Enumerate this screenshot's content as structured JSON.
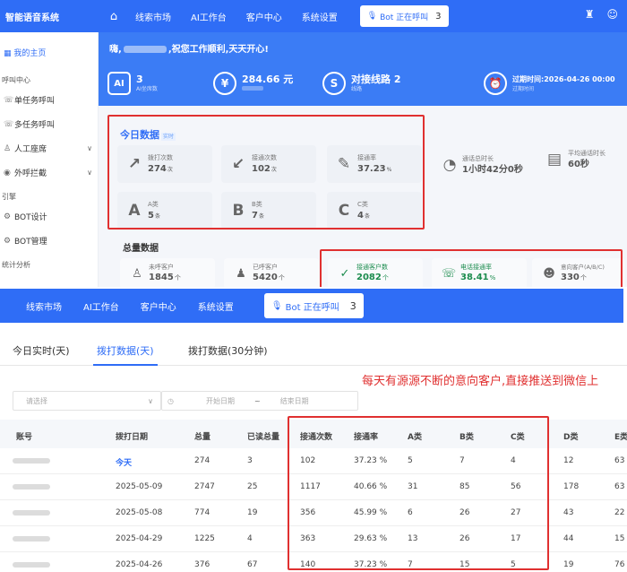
{
  "header": {
    "logo": "智能语音系统",
    "nav": [
      "线索市场",
      "AI工作台",
      "客户中心",
      "系统设置"
    ],
    "bot_status": "Bot 正在呼叫",
    "bot_count": "3"
  },
  "sidebar": {
    "home": "我的主页",
    "groups": [
      {
        "label": "呼叫中心",
        "items": [
          {
            "label": "单任务呼叫",
            "icon": "phone-icon"
          },
          {
            "label": "多任务呼叫",
            "icon": "phone-icon"
          },
          {
            "label": "人工座席",
            "icon": "person-icon",
            "chevron": true
          },
          {
            "label": "外呼拦截",
            "icon": "shield-icon",
            "chevron": true
          }
        ]
      },
      {
        "label": "引擎",
        "items": [
          {
            "label": "BOT设计",
            "icon": "gear-icon"
          },
          {
            "label": "BOT管理",
            "icon": "gear-icon"
          }
        ]
      },
      {
        "label": "统计分析",
        "items": []
      }
    ]
  },
  "banner": {
    "greet_prefix": "嗨,",
    "greet_suffix": ",祝您工作顺利,天天开心!",
    "stats": [
      {
        "icon": "AI",
        "value": "3",
        "sub": "AI坐席数"
      },
      {
        "icon": "¥",
        "value": "284.66 元",
        "sub": ""
      },
      {
        "icon": "S",
        "value": "对接线路 2",
        "sub": "线路"
      },
      {
        "icon": "⏰",
        "value": "过期时间:2026-04-26 00:00",
        "sub": "过期时间"
      }
    ]
  },
  "today": {
    "title": "今日数据",
    "tag": "实时",
    "cards": [
      {
        "icon": "↗",
        "label": "拨打次数",
        "value": "274",
        "unit": "次"
      },
      {
        "icon": "↙",
        "label": "接通次数",
        "value": "102",
        "unit": "次"
      },
      {
        "icon": "✎",
        "label": "接通率",
        "value": "37.23",
        "unit": "%"
      },
      {
        "icon": "◔",
        "label": "通话总时长",
        "value": "1小时42分0秒",
        "unit": ""
      },
      {
        "icon": "▤",
        "label": "平均通话时长",
        "value": "60秒",
        "unit": ""
      },
      {
        "icon": "A",
        "label": "A类",
        "value": "5",
        "unit": "条"
      },
      {
        "icon": "B",
        "label": "B类",
        "value": "7",
        "unit": "条"
      },
      {
        "icon": "C",
        "label": "C类",
        "value": "4",
        "unit": "条"
      }
    ]
  },
  "total": {
    "title": "总量数据",
    "cards": [
      {
        "icon": "♙",
        "label": "未呼客户",
        "value": "1845",
        "unit": "个"
      },
      {
        "icon": "♟",
        "label": "已呼客户",
        "value": "5420",
        "unit": "个"
      },
      {
        "icon": "✓",
        "label": "接通客户数",
        "value": "2082",
        "unit": "个"
      },
      {
        "icon": "☏",
        "label": "电话接通率",
        "value": "38.41",
        "unit": "%"
      },
      {
        "icon": "☻",
        "label": "意向客户(A/B/C)",
        "value": "330",
        "unit": "个"
      }
    ]
  },
  "lower": {
    "nav": [
      "线索市场",
      "AI工作台",
      "客户中心",
      "系统设置"
    ],
    "bot_status": "Bot 正在呼叫",
    "bot_count": "3",
    "tabs": [
      "今日实时(天)",
      "拨打数据(天)",
      "拨打数据(30分钟)"
    ],
    "active_tab": 1,
    "filter": {
      "select_placeholder": "请选择",
      "start_placeholder": "开始日期",
      "separator": "~",
      "end_placeholder": "结束日期"
    },
    "annotation": "每天有源源不断的意向客户,直接推送到微信上",
    "columns": [
      "账号",
      "拨打日期",
      "总量",
      "已读总量",
      "接通次数",
      "接通率",
      "A类",
      "B类",
      "C类",
      "D类",
      "E类"
    ],
    "rows": [
      [
        "",
        "今天",
        "274",
        "3",
        "102",
        "37.23 %",
        "5",
        "7",
        "4",
        "12",
        "63"
      ],
      [
        "",
        "2025-05-09",
        "2747",
        "25",
        "1117",
        "40.66 %",
        "31",
        "85",
        "56",
        "178",
        "63"
      ],
      [
        "",
        "2025-05-08",
        "774",
        "19",
        "356",
        "45.99 %",
        "6",
        "26",
        "27",
        "43",
        "22"
      ],
      [
        "",
        "2025-04-29",
        "1225",
        "4",
        "363",
        "29.63 %",
        "13",
        "26",
        "17",
        "44",
        "15"
      ],
      [
        "",
        "2025-04-26",
        "376",
        "67",
        "140",
        "37.23 %",
        "7",
        "15",
        "5",
        "19",
        "76"
      ]
    ]
  }
}
